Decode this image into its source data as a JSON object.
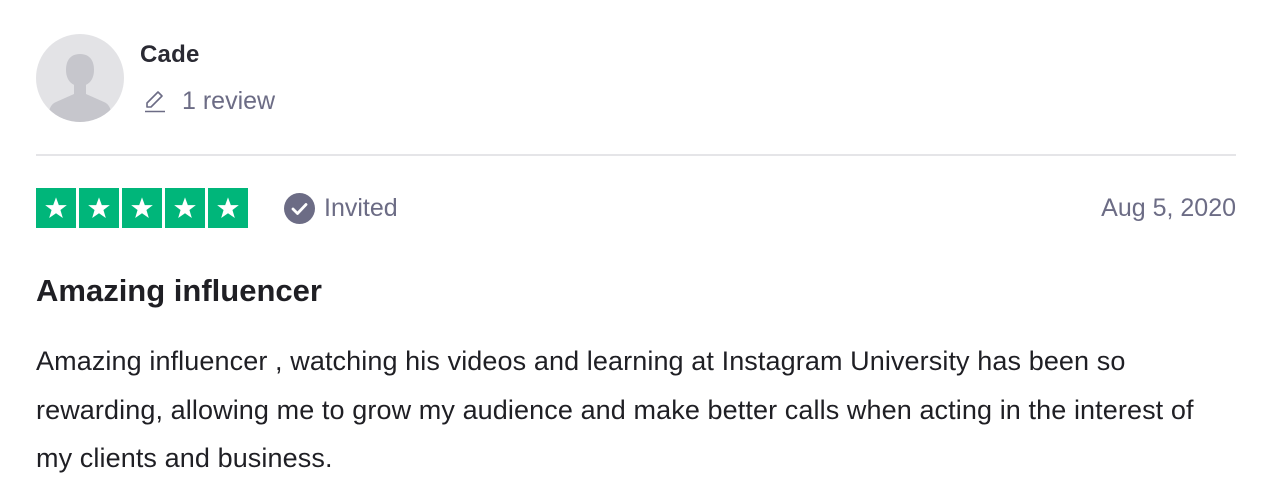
{
  "consumer": {
    "name": "Cade",
    "review_count": "1 review",
    "avatar_icon": "user-silhouette-icon",
    "pencil_icon": "pencil-icon"
  },
  "review": {
    "rating": 5,
    "max_rating": 5,
    "star_color": "#00b67a",
    "verified_label": "Invited",
    "verified_icon": "check-circle-icon",
    "date": "Aug 5, 2020",
    "title": "Amazing influencer",
    "body": "Amazing influencer , watching his videos and learning at Instagram University has been so rewarding, allowing me to grow my audience and make better calls when acting in the interest of my clients and business."
  },
  "colors": {
    "muted_text": "#6c6c85",
    "divider": "#e5e5e8",
    "avatar_bg": "#e3e3e6"
  }
}
